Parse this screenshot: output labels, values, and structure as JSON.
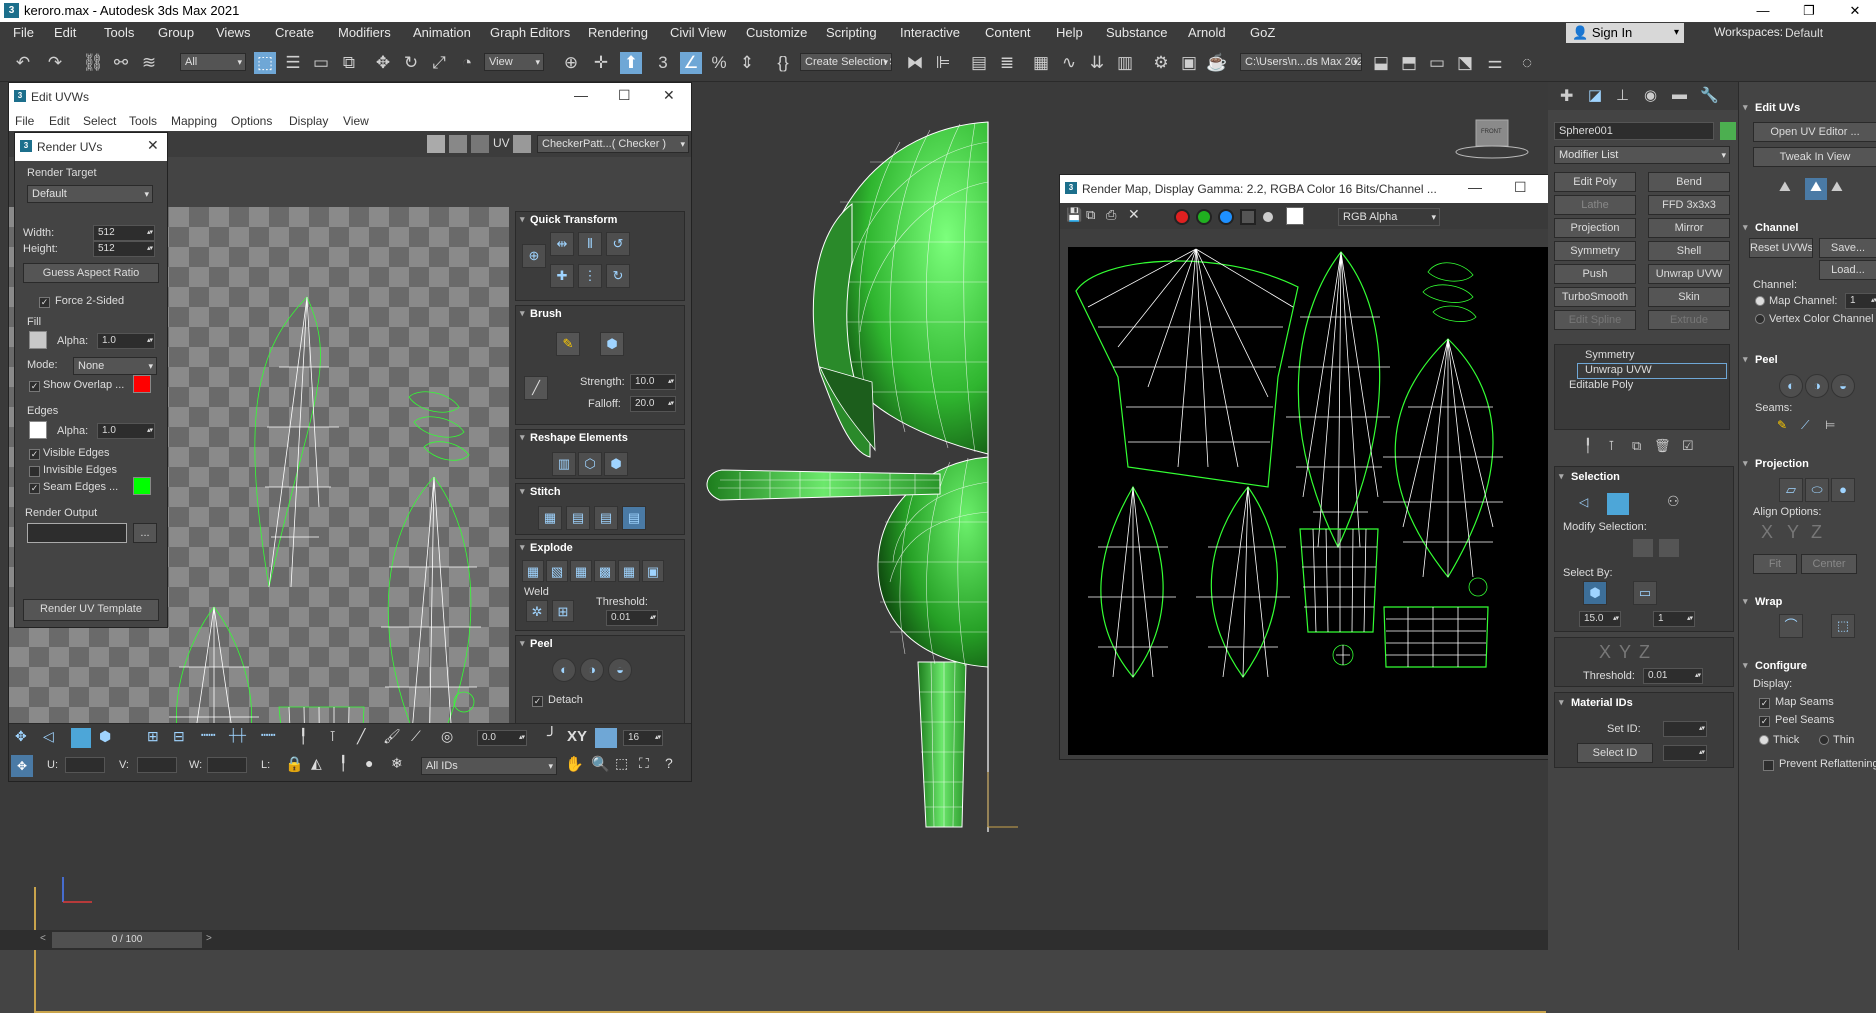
{
  "titlebar": {
    "title": "keroro.max - Autodesk 3ds Max 2021"
  },
  "menu": [
    "File",
    "Edit",
    "Tools",
    "Group",
    "Views",
    "Create",
    "Modifiers",
    "Animation",
    "Graph Editors",
    "Rendering",
    "Civil View",
    "Customize",
    "Scripting",
    "Interactive",
    "Content",
    "Help",
    "Substance",
    "Arnold",
    "GoZ"
  ],
  "menu_right": {
    "sign_in": "Sign In",
    "workspaces_label": "Workspaces:",
    "workspaces_value": "Default"
  },
  "toolbar": {
    "filter": "All",
    "ref_coord": "View",
    "selection_set": "Create Selection Se",
    "project_path": "C:\\Users\\n...ds Max 2021"
  },
  "edit_uvws": {
    "title": "Edit UVWs",
    "menu": [
      "File",
      "Edit",
      "Select",
      "Tools",
      "Mapping",
      "Options",
      "Display",
      "View"
    ],
    "uv_label": "UV",
    "checker": "CheckerPatt...( Checker )",
    "quick_transform": "Quick Transform",
    "brush": {
      "title": "Brush",
      "strength_label": "Strength:",
      "strength": "10.0",
      "falloff_label": "Falloff:",
      "falloff": "20.0"
    },
    "reshape": "Reshape Elements",
    "stitch": "Stitch",
    "explode": {
      "title": "Explode",
      "weld": "Weld",
      "threshold_label": "Threshold:",
      "threshold": "0.01"
    },
    "peel": {
      "title": "Peel",
      "detach": "Detach"
    },
    "bottom": {
      "spin_value": "0.0",
      "xy": "XY",
      "grid": "16",
      "u": "U:",
      "v": "V:",
      "w": "W:",
      "l": "L:",
      "ids": "All IDs"
    }
  },
  "render_uvs": {
    "title": "Render UVs",
    "target_label": "Render Target",
    "target": "Default",
    "width_label": "Width:",
    "width": "512",
    "height_label": "Height:",
    "height": "512",
    "guess": "Guess Aspect Ratio",
    "force2": "Force 2-Sided",
    "fill": "Fill",
    "alpha_label": "Alpha:",
    "fill_alpha": "1.0",
    "mode_label": "Mode:",
    "mode": "None",
    "show_overlap": "Show Overlap ...",
    "edges": "Edges",
    "edge_alpha": "1.0",
    "visible_edges": "Visible Edges",
    "invisible_edges": "Invisible Edges",
    "seam_edges": "Seam Edges ...",
    "render_output": "Render Output",
    "browse": "...",
    "render_btn": "Render UV Template",
    "colors": {
      "fill": "#c8c8c8",
      "edge": "#ffffff",
      "overlap": "#ff0000",
      "seam": "#00ff00"
    }
  },
  "render_map": {
    "title": "Render Map, Display Gamma: 2.2, RGBA Color 16 Bits/Channel ...",
    "channel": "RGB Alpha",
    "colors": {
      "red": "#e02020",
      "green": "#20b020",
      "blue": "#1e90ff"
    }
  },
  "command_panel": {
    "object_name": "Sphere001",
    "modifier_list": "Modifier List",
    "mod_buttons": [
      "Edit Poly",
      "Bend",
      "Lathe",
      "FFD 3x3x3",
      "Projection",
      "Mirror",
      "Symmetry",
      "Shell",
      "Push",
      "Unwrap UVW",
      "TurboSmooth",
      "Skin",
      "Edit Spline",
      "Extrude"
    ],
    "stack": [
      "Symmetry",
      "Unwrap UVW",
      "Editable Poly"
    ],
    "selection": "Selection",
    "modify_selection": "Modify Selection:",
    "select_by": "Select By:",
    "angle": "15.0",
    "count": "1",
    "threshold_label": "Threshold:",
    "threshold": "0.01",
    "material_ids": "Material IDs",
    "set_id": "Set ID:",
    "select_id": "Select ID",
    "edit_uvs": "Edit UVs",
    "open_uv_editor": "Open UV Editor ...",
    "tweak_in_view": "Tweak In View",
    "channel_title": "Channel",
    "reset_uvws": "Reset UVWs",
    "save": "Save...",
    "load": "Load...",
    "channel_label": "Channel:",
    "map_channel": "Map Channel:",
    "map_channel_value": "1",
    "vertex_color_channel": "Vertex Color Channel",
    "peel": "Peel",
    "seams": "Seams:",
    "projection": "Projection",
    "align_options": "Align Options:",
    "fit": "Fit",
    "center": "Center",
    "wrap": "Wrap",
    "configure": "Configure",
    "display": "Display:",
    "map_seams": "Map Seams",
    "peel_seams": "Peel Seams",
    "thick": "Thick",
    "thin": "Thin",
    "prevent": "Prevent Reflattening",
    "accent": "#4caf50"
  },
  "viewport": {
    "front_label": "FRONT"
  },
  "timeline": {
    "frames": "0 / 100"
  }
}
